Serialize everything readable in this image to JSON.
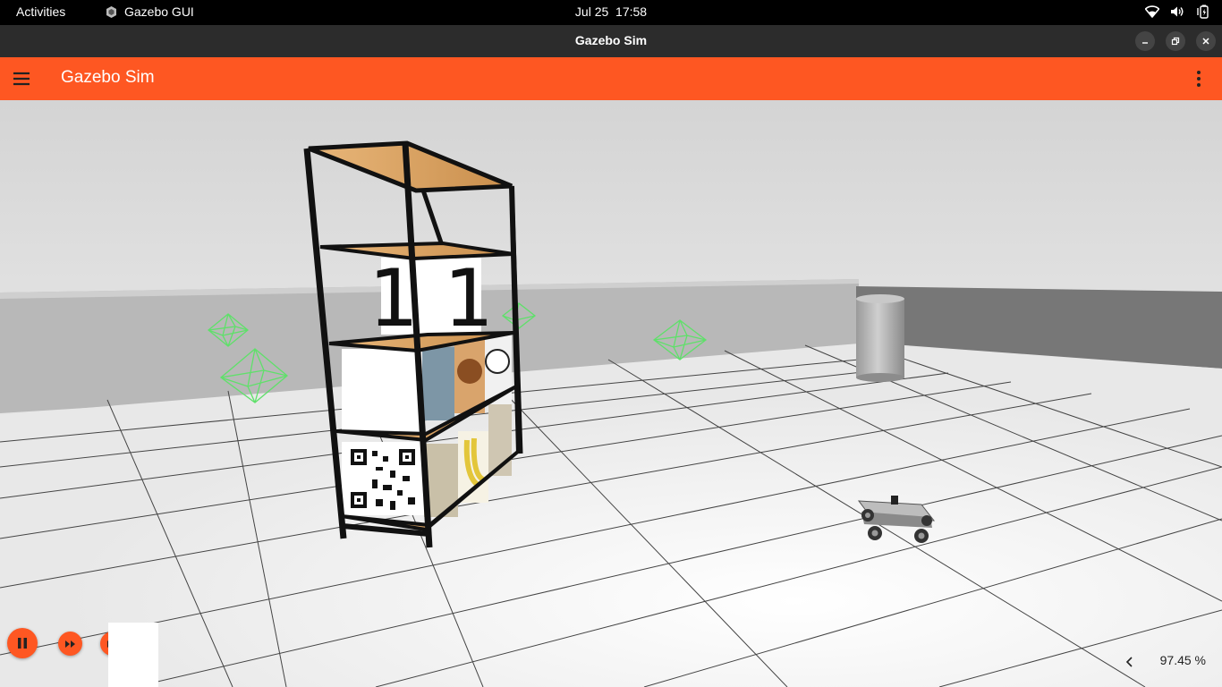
{
  "system_bar": {
    "activities_label": "Activities",
    "app_menu_label": "Gazebo GUI",
    "date": "Jul 25",
    "time": "17:58",
    "tray_icons": [
      "wifi-icon",
      "volume-icon",
      "battery-icon"
    ]
  },
  "window": {
    "title": "Gazebo Sim",
    "controls": [
      "minimize-icon",
      "maximize-icon",
      "close-icon"
    ]
  },
  "app_toolbar": {
    "title": "Gazebo Sim",
    "menu_icon": "hamburger-menu-icon",
    "overflow_icon": "more-vert-icon",
    "accent_color": "#fe5722"
  },
  "scene": {
    "shelf_box_label": "1 1",
    "objects": [
      "shelf",
      "cylinder",
      "robot",
      "waypoint-markers"
    ]
  },
  "playback": {
    "controls": [
      "pause-icon",
      "step-icon",
      "multi-step-icon"
    ]
  },
  "status": {
    "real_time_factor": "97.45 %",
    "collapse_icon": "chevron-left-icon"
  }
}
